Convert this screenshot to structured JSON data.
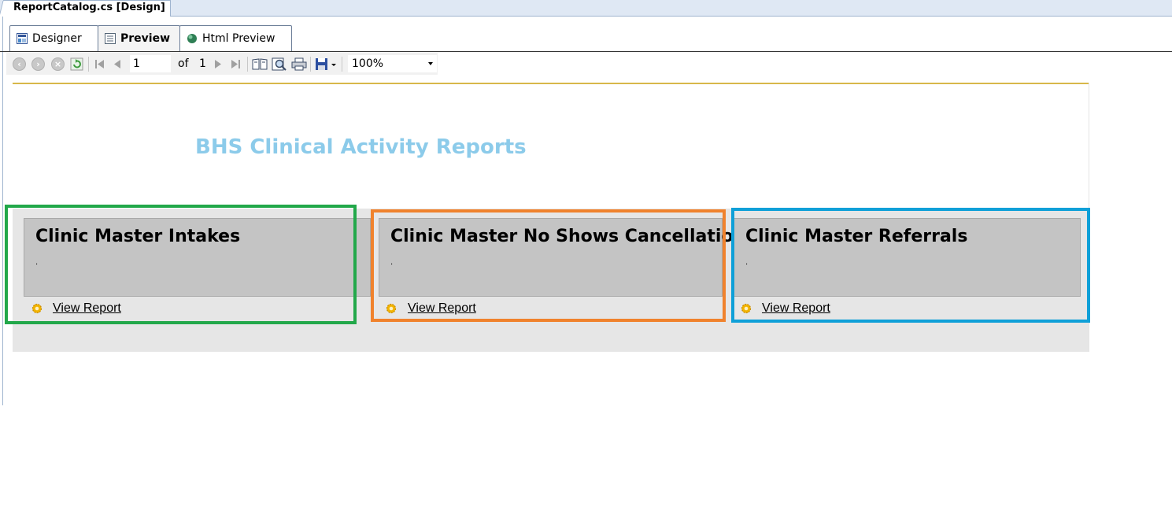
{
  "window": {
    "doc_tab": "ReportCatalog.cs [Design]"
  },
  "view_tabs": [
    {
      "label": "Designer",
      "active": false
    },
    {
      "label": "Preview",
      "active": true
    },
    {
      "label": "Html Preview",
      "active": false
    }
  ],
  "toolbar": {
    "page_value": "1",
    "of_label": "of",
    "total_pages": "1",
    "zoom_value": "100%"
  },
  "report": {
    "title": "BHS Clinical Activity Reports",
    "cards": [
      {
        "title": "Clinic Master Intakes",
        "desc": ".",
        "link": "View Report"
      },
      {
        "title": "Clinic Master No Shows Cancellations",
        "desc": ".",
        "link": "View Report"
      },
      {
        "title": "Clinic Master Referrals",
        "desc": ".",
        "link": "View Report"
      }
    ]
  },
  "colors": {
    "title": "#8ccbea",
    "highlight_green": "#22a84a",
    "highlight_orange": "#f0822d",
    "highlight_blue": "#0fa0d8",
    "card_bg": "#c4c4c4",
    "band_bg": "#e6e6e6"
  },
  "icons": {
    "view_report": "gear-icon",
    "designer_tab": "designer-icon",
    "preview_tab": "preview-icon",
    "html_preview_tab": "globe-icon"
  }
}
